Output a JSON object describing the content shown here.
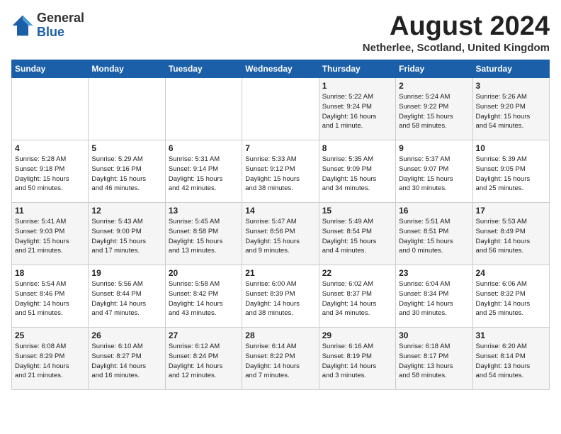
{
  "logo": {
    "general": "General",
    "blue": "Blue"
  },
  "title": {
    "month_year": "August 2024",
    "location": "Netherlee, Scotland, United Kingdom"
  },
  "headers": [
    "Sunday",
    "Monday",
    "Tuesday",
    "Wednesday",
    "Thursday",
    "Friday",
    "Saturday"
  ],
  "weeks": [
    [
      {
        "day": "",
        "info": ""
      },
      {
        "day": "",
        "info": ""
      },
      {
        "day": "",
        "info": ""
      },
      {
        "day": "",
        "info": ""
      },
      {
        "day": "1",
        "info": "Sunrise: 5:22 AM\nSunset: 9:24 PM\nDaylight: 16 hours\nand 1 minute."
      },
      {
        "day": "2",
        "info": "Sunrise: 5:24 AM\nSunset: 9:22 PM\nDaylight: 15 hours\nand 58 minutes."
      },
      {
        "day": "3",
        "info": "Sunrise: 5:26 AM\nSunset: 9:20 PM\nDaylight: 15 hours\nand 54 minutes."
      }
    ],
    [
      {
        "day": "4",
        "info": "Sunrise: 5:28 AM\nSunset: 9:18 PM\nDaylight: 15 hours\nand 50 minutes."
      },
      {
        "day": "5",
        "info": "Sunrise: 5:29 AM\nSunset: 9:16 PM\nDaylight: 15 hours\nand 46 minutes."
      },
      {
        "day": "6",
        "info": "Sunrise: 5:31 AM\nSunset: 9:14 PM\nDaylight: 15 hours\nand 42 minutes."
      },
      {
        "day": "7",
        "info": "Sunrise: 5:33 AM\nSunset: 9:12 PM\nDaylight: 15 hours\nand 38 minutes."
      },
      {
        "day": "8",
        "info": "Sunrise: 5:35 AM\nSunset: 9:09 PM\nDaylight: 15 hours\nand 34 minutes."
      },
      {
        "day": "9",
        "info": "Sunrise: 5:37 AM\nSunset: 9:07 PM\nDaylight: 15 hours\nand 30 minutes."
      },
      {
        "day": "10",
        "info": "Sunrise: 5:39 AM\nSunset: 9:05 PM\nDaylight: 15 hours\nand 25 minutes."
      }
    ],
    [
      {
        "day": "11",
        "info": "Sunrise: 5:41 AM\nSunset: 9:03 PM\nDaylight: 15 hours\nand 21 minutes."
      },
      {
        "day": "12",
        "info": "Sunrise: 5:43 AM\nSunset: 9:00 PM\nDaylight: 15 hours\nand 17 minutes."
      },
      {
        "day": "13",
        "info": "Sunrise: 5:45 AM\nSunset: 8:58 PM\nDaylight: 15 hours\nand 13 minutes."
      },
      {
        "day": "14",
        "info": "Sunrise: 5:47 AM\nSunset: 8:56 PM\nDaylight: 15 hours\nand 9 minutes."
      },
      {
        "day": "15",
        "info": "Sunrise: 5:49 AM\nSunset: 8:54 PM\nDaylight: 15 hours\nand 4 minutes."
      },
      {
        "day": "16",
        "info": "Sunrise: 5:51 AM\nSunset: 8:51 PM\nDaylight: 15 hours\nand 0 minutes."
      },
      {
        "day": "17",
        "info": "Sunrise: 5:53 AM\nSunset: 8:49 PM\nDaylight: 14 hours\nand 56 minutes."
      }
    ],
    [
      {
        "day": "18",
        "info": "Sunrise: 5:54 AM\nSunset: 8:46 PM\nDaylight: 14 hours\nand 51 minutes."
      },
      {
        "day": "19",
        "info": "Sunrise: 5:56 AM\nSunset: 8:44 PM\nDaylight: 14 hours\nand 47 minutes."
      },
      {
        "day": "20",
        "info": "Sunrise: 5:58 AM\nSunset: 8:42 PM\nDaylight: 14 hours\nand 43 minutes."
      },
      {
        "day": "21",
        "info": "Sunrise: 6:00 AM\nSunset: 8:39 PM\nDaylight: 14 hours\nand 38 minutes."
      },
      {
        "day": "22",
        "info": "Sunrise: 6:02 AM\nSunset: 8:37 PM\nDaylight: 14 hours\nand 34 minutes."
      },
      {
        "day": "23",
        "info": "Sunrise: 6:04 AM\nSunset: 8:34 PM\nDaylight: 14 hours\nand 30 minutes."
      },
      {
        "day": "24",
        "info": "Sunrise: 6:06 AM\nSunset: 8:32 PM\nDaylight: 14 hours\nand 25 minutes."
      }
    ],
    [
      {
        "day": "25",
        "info": "Sunrise: 6:08 AM\nSunset: 8:29 PM\nDaylight: 14 hours\nand 21 minutes."
      },
      {
        "day": "26",
        "info": "Sunrise: 6:10 AM\nSunset: 8:27 PM\nDaylight: 14 hours\nand 16 minutes."
      },
      {
        "day": "27",
        "info": "Sunrise: 6:12 AM\nSunset: 8:24 PM\nDaylight: 14 hours\nand 12 minutes."
      },
      {
        "day": "28",
        "info": "Sunrise: 6:14 AM\nSunset: 8:22 PM\nDaylight: 14 hours\nand 7 minutes."
      },
      {
        "day": "29",
        "info": "Sunrise: 6:16 AM\nSunset: 8:19 PM\nDaylight: 14 hours\nand 3 minutes."
      },
      {
        "day": "30",
        "info": "Sunrise: 6:18 AM\nSunset: 8:17 PM\nDaylight: 13 hours\nand 58 minutes."
      },
      {
        "day": "31",
        "info": "Sunrise: 6:20 AM\nSunset: 8:14 PM\nDaylight: 13 hours\nand 54 minutes."
      }
    ]
  ]
}
